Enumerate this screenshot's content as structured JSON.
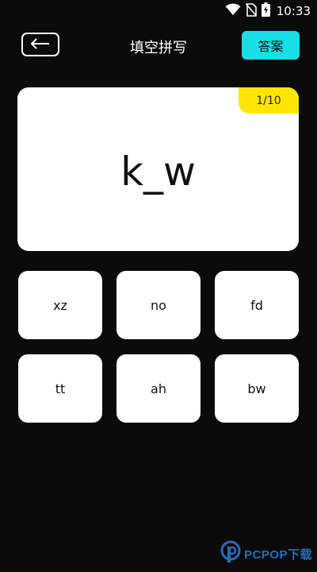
{
  "status_bar": {
    "time": "10:33",
    "icons": [
      "wifi-icon",
      "no-sim-icon",
      "battery-charging-icon"
    ]
  },
  "header": {
    "back_icon": "arrow-left-icon",
    "title": "填空拼写",
    "answer_label": "答案"
  },
  "question": {
    "progress": "1/10",
    "word": "k_w"
  },
  "options": [
    {
      "label": "xz"
    },
    {
      "label": "no"
    },
    {
      "label": "fd"
    },
    {
      "label": "tt"
    },
    {
      "label": "ah"
    },
    {
      "label": "bw"
    }
  ],
  "watermark": {
    "text": "PCPOP下载",
    "icon": "pcpop-logo-icon"
  },
  "colors": {
    "background": "#0b0b0b",
    "accent_cyan": "#16e0e6",
    "badge_yellow": "#ffe600",
    "card": "#ffffff"
  }
}
